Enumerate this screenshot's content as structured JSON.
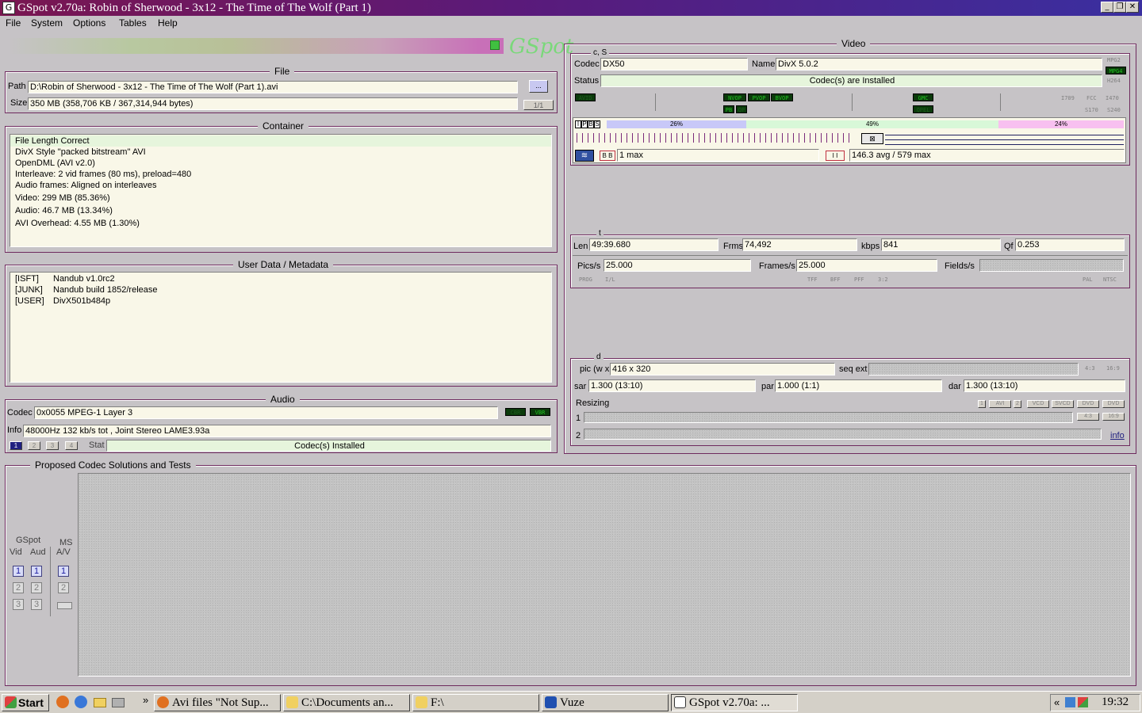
{
  "window": {
    "title": "GSpot v2.70a: Robin of Sherwood - 3x12 - The Time of The Wolf (Part 1)",
    "controls": [
      "_",
      "❐",
      "✕"
    ]
  },
  "menu": [
    "File",
    "System",
    "Options",
    "Tables",
    "Help"
  ],
  "logo": "GSpot",
  "file": {
    "title": "File",
    "path_label": "Path",
    "path": "D:\\Robin of Sherwood - 3x12 - The Time of The Wolf (Part 1).avi",
    "browse": "...",
    "size_label": "Size",
    "size": "350 MB (358,706 KB / 367,314,944 bytes)",
    "page": "1/1"
  },
  "container": {
    "title": "Container",
    "lines": [
      "File Length Correct",
      "DivX Style \"packed bitstream\" AVI",
      "OpenDML (AVI v2.0)",
      "Interleave: 2 vid frames (80 ms), preload=480",
      "Audio frames: Aligned on interleaves",
      "Video: 299 MB (85.36%)",
      "Audio: 46.7 MB (13.34%)",
      "AVI Overhead: 4.55 MB (1.30%)"
    ]
  },
  "metadata": {
    "title": "User Data / Metadata",
    "rows": [
      {
        "key": "[ISFT]",
        "value": "Nandub v1.0rc2"
      },
      {
        "key": "[JUNK]",
        "value": "Nandub build 1852/release"
      },
      {
        "key": "[USER]",
        "value": "DivX501b484p"
      }
    ]
  },
  "audio": {
    "title": "Audio",
    "codec_label": "Codec",
    "codec": "0x0055 MPEG-1 Layer 3",
    "cbr": "CBR",
    "vbr": "VBR",
    "info_label": "Info",
    "info": "48000Hz  132 kb/s tot , Joint Stereo LAME3.93a",
    "tracks": [
      "1",
      "2",
      "3",
      "4"
    ],
    "stat_label": "Stat",
    "stat": "Codec(s) Installed"
  },
  "video": {
    "title": "Video",
    "cs_title": "c, S",
    "codec_label": "Codec",
    "codec": "DX50",
    "name_label": "Name",
    "name": "DivX 5.0.2",
    "status_label": "Status",
    "status": "Codec(s) are Installed",
    "side_tags": [
      "MPG2",
      "MPG4",
      "H264"
    ],
    "flags_row1": [
      "AVID",
      "NVOP",
      "PVOP",
      "BVOP",
      "GMC",
      "I709",
      "FCC",
      "I470"
    ],
    "flags_row2": [
      "PB",
      "QP",
      "QPEL",
      "S170",
      "S240"
    ],
    "frame_types": [
      "I",
      "P",
      "B",
      "S"
    ],
    "pct_i": "26%",
    "pct_p": "49%",
    "pct_b": "24%",
    "bframes": "1 max",
    "bitrate_info": "146.3 avg / 579 max",
    "t_title": "t",
    "len_label": "Len",
    "len": "49:39.680",
    "frms_label": "Frms",
    "frms": "74,492",
    "kbps_label": "kbps",
    "kbps": "841",
    "qf_label": "Qf",
    "qf": "0.253",
    "pics_label": "Pics/s",
    "pics": "25.000",
    "frames_label": "Frames/s",
    "frames": "25.000",
    "fields_label": "Fields/s",
    "scan_tags": [
      "PROG",
      "I/L",
      "TFF",
      "BFF",
      "PFF",
      "3:2",
      "PAL",
      "NTSC"
    ],
    "d_title": "d",
    "pic_label": "pic (w x",
    "pic": "416 x 320",
    "seq_label": "seq ext",
    "ar_tags": [
      "4:3",
      "16:9"
    ],
    "sar_label": "sar",
    "sar": "1.300 (13:10)",
    "par_label": "par",
    "par": "1.000 (1:1)",
    "dar_label": "dar",
    "dar": "1.300 (13:10)",
    "resizing_label": "Resizing",
    "resize_btns": [
      "1",
      "AVI",
      "2",
      "VCD",
      "SVCD",
      "DVD",
      "DVD"
    ],
    "resize_btns2": [
      "4:3",
      "16:9"
    ],
    "row1": "1",
    "row2": "2",
    "info_link": "info"
  },
  "proposed": {
    "title": "Proposed Codec Solutions and Tests",
    "gspot": "GSpot",
    "vid": "Vid",
    "aud": "Aud",
    "ms": "MS",
    "av": "A/V",
    "nums": [
      "1",
      "2",
      "3"
    ]
  },
  "taskbar": {
    "start": "Start",
    "tasks": [
      "Avi files \"Not Sup...",
      "C:\\Documents an...",
      "F:\\",
      "Vuze",
      "GSpot v2.70a: ..."
    ],
    "chevron": "»",
    "tray_chevron": "«",
    "clock": "19:32"
  }
}
